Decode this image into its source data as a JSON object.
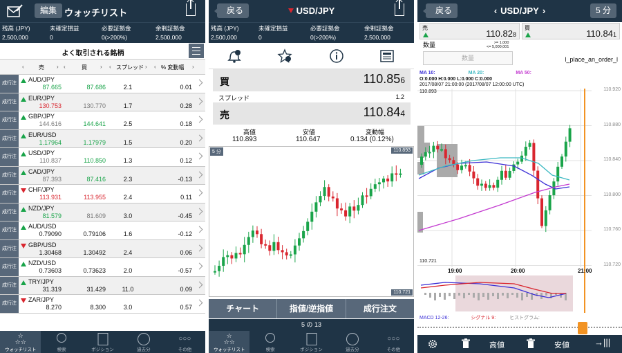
{
  "watchlist": {
    "edit_label": "編集",
    "title": "ウォッチリスト",
    "account": {
      "labels": [
        "残高 (JPY)",
        "未確定損益",
        "必要証拠金",
        "余剰証拠金"
      ],
      "values": [
        "2,500,000",
        "0",
        "0(>200%)",
        "2,500,000"
      ]
    },
    "section_title": "よく取引される銘柄",
    "columns": [
      "売",
      "買",
      "スプレッド",
      "% 変動幅"
    ],
    "order_label": "成行注文",
    "rows": [
      {
        "name": "AUD/JPY",
        "dir": "up",
        "bid": "87.665",
        "ask": "87.686",
        "bidc": "green",
        "askc": "green",
        "spread": "2.1",
        "change": "0.01"
      },
      {
        "name": "EUR/JPY",
        "dir": "up",
        "bid": "130.753",
        "ask": "130.770",
        "bidc": "red",
        "askc": "gray",
        "spread": "1.7",
        "change": "0.28"
      },
      {
        "name": "GBP/JPY",
        "dir": "up",
        "bid": "144.616",
        "ask": "144.641",
        "bidc": "gray",
        "askc": "green",
        "spread": "2.5",
        "change": "0.18"
      },
      {
        "name": "EUR/USD",
        "dir": "up",
        "bid": "1.17964",
        "ask": "1.17979",
        "bidc": "green",
        "askc": "green",
        "spread": "1.5",
        "change": "0.20"
      },
      {
        "name": "USD/JPY",
        "dir": "up",
        "bid": "110.837",
        "ask": "110.850",
        "bidc": "gray",
        "askc": "green",
        "spread": "1.3",
        "change": "0.12"
      },
      {
        "name": "CAD/JPY",
        "dir": "up",
        "bid": "87.393",
        "ask": "87.416",
        "bidc": "gray",
        "askc": "green",
        "spread": "2.3",
        "change": "-0.13"
      },
      {
        "name": "CHF/JPY",
        "dir": "down",
        "bid": "113.931",
        "ask": "113.955",
        "bidc": "red",
        "askc": "red",
        "spread": "2.4",
        "change": "0.11"
      },
      {
        "name": "NZD/JPY",
        "dir": "up",
        "bid": "81.579",
        "ask": "81.609",
        "bidc": "green",
        "askc": "gray",
        "spread": "3.0",
        "change": "-0.45"
      },
      {
        "name": "AUD/USD",
        "dir": "up",
        "bid": "0.79090",
        "ask": "0.79106",
        "bidc": "dark",
        "askc": "dark",
        "spread": "1.6",
        "change": "-0.12"
      },
      {
        "name": "GBP/USD",
        "dir": "down",
        "bid": "1.30468",
        "ask": "1.30492",
        "bidc": "dark",
        "askc": "dark",
        "spread": "2.4",
        "change": "0.06"
      },
      {
        "name": "NZD/USD",
        "dir": "up",
        "bid": "0.73603",
        "ask": "0.73623",
        "bidc": "dark",
        "askc": "dark",
        "spread": "2.0",
        "change": "-0.57"
      },
      {
        "name": "TRY/JPY",
        "dir": "up",
        "bid": "31.319",
        "ask": "31.429",
        "bidc": "dark",
        "askc": "dark",
        "spread": "11.0",
        "change": "0.09"
      },
      {
        "name": "ZAR/JPY",
        "dir": "down",
        "bid": "8.270",
        "ask": "8.300",
        "bidc": "dark",
        "askc": "dark",
        "spread": "3.0",
        "change": "0.57"
      }
    ]
  },
  "tabs": [
    {
      "label": "ウォッチリスト",
      "icon": "stars-icon"
    },
    {
      "label": "検索",
      "icon": "search-icon"
    },
    {
      "label": "ポジション",
      "icon": "positions-icon"
    },
    {
      "label": "過去分",
      "icon": "clock-icon"
    },
    {
      "label": "その他",
      "icon": "more-icon"
    }
  ],
  "detail": {
    "back_label": "戻る",
    "title": "USD/JPY",
    "account_values": [
      "2,500,000",
      "0",
      "0(>200%)",
      "2,500,000"
    ],
    "buy_label": "買",
    "buy_price_main": "110.85",
    "buy_price_last": "6",
    "spread_label": "スプレッド",
    "spread_value": "1.2",
    "sell_label": "売",
    "sell_price_main": "110.84",
    "sell_price_last": "4",
    "stats_labels": [
      "高値",
      "安値",
      "変動幅"
    ],
    "stats_values": [
      "110.893",
      "110.647",
      "0.134 (0.12%)"
    ],
    "timeframe": "5 分",
    "chart_high": "110.893",
    "chart_low": "110.721",
    "segments": [
      "チャート",
      "指値/逆指値",
      "成行注文"
    ],
    "pager": "5 の 13"
  },
  "chartpage": {
    "back_label": "戻る",
    "title": "USD/JPY",
    "timeframe": "5 分",
    "sell_label": "売",
    "sell_price": "110.82",
    "sell_last": "8",
    "buy_label": "買",
    "buy_price": "110.84",
    "buy_last": "1",
    "qty_label": "数量",
    "qty_limits": ">= 1,000\n<= 5,000,001",
    "qty_placeholder": "数量",
    "order_link": "l_place_an_order_l",
    "ma_labels": [
      "MA 10:",
      "MA 20:",
      "MA 50:"
    ],
    "ohlc": "O:0.000 H:0.000 L:0.000 C:0.000",
    "range": "2017/08/07 21:00:00 (2017/08/07 12:00:00 UTC)",
    "hi_label": "110.893",
    "lo_label": "110.721",
    "yticks": [
      "110.920",
      "110.880",
      "110.840",
      "110.800",
      "110.760",
      "110.720"
    ],
    "xticks": [
      "19:00",
      "20:00",
      "21:00"
    ],
    "macd_label": "MACD 12-26:",
    "signal_label": "シグナル 9:",
    "hist_label": "ヒストグラム:",
    "bottom": {
      "high": "高値",
      "low": "安値"
    }
  },
  "colors": {
    "navy": "#1f3446",
    "up": "#1aa44a",
    "down": "#d9262f",
    "ma10": "#3b2fd6",
    "ma20": "#3cb9c2",
    "ma50": "#c33ad0"
  }
}
